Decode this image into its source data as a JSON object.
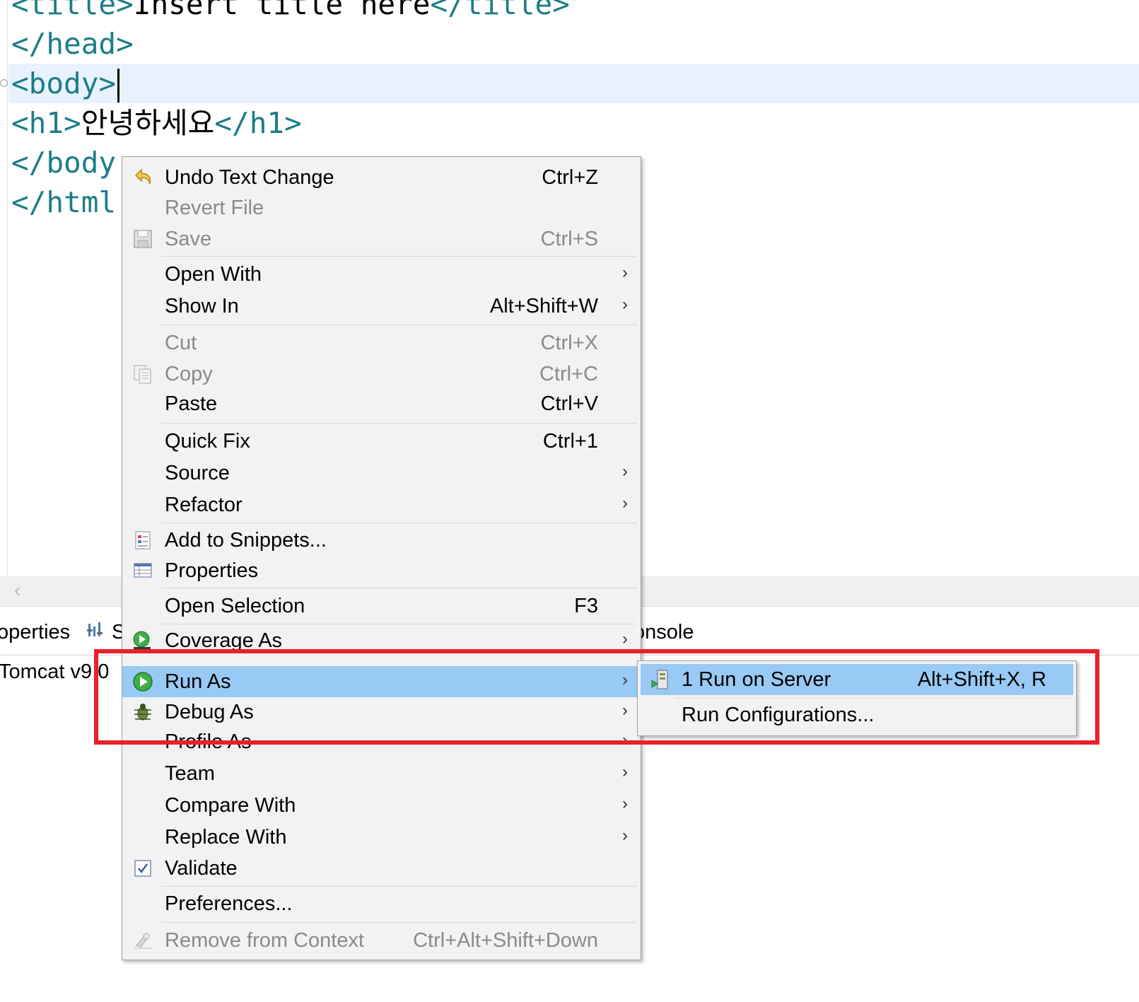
{
  "editor": {
    "lines": {
      "l1": {
        "open": "<title>",
        "text": "Insert title here",
        "close": "</title>"
      },
      "l2": {
        "tag": "</head>"
      },
      "l3": {
        "tag": "<body>"
      },
      "l4": {
        "open": "<h1>",
        "text": "안녕하세요",
        "close": "</h1>"
      },
      "l5": {
        "tag": "</body"
      },
      "l6": {
        "tag": "</html"
      }
    }
  },
  "bottom_panel": {
    "tab_properties": "operties",
    "tab_servers": "S",
    "tab_console": "onsole",
    "server_row": "Tomcat v9.0"
  },
  "context_menu": {
    "undo": {
      "label": "Undo Text Change",
      "shortcut": "Ctrl+Z"
    },
    "revert": {
      "label": "Revert File"
    },
    "save": {
      "label": "Save",
      "shortcut": "Ctrl+S"
    },
    "open_with": {
      "label": "Open With"
    },
    "show_in": {
      "label": "Show In",
      "shortcut": "Alt+Shift+W"
    },
    "cut": {
      "label": "Cut",
      "shortcut": "Ctrl+X"
    },
    "copy": {
      "label": "Copy",
      "shortcut": "Ctrl+C"
    },
    "paste": {
      "label": "Paste",
      "shortcut": "Ctrl+V"
    },
    "quick_fix": {
      "label": "Quick Fix",
      "shortcut": "Ctrl+1"
    },
    "source": {
      "label": "Source"
    },
    "refactor": {
      "label": "Refactor"
    },
    "add_snippets": {
      "label": "Add to Snippets..."
    },
    "properties": {
      "label": "Properties"
    },
    "open_selection": {
      "label": "Open Selection",
      "shortcut": "F3"
    },
    "coverage_as": {
      "label": "Coverage As"
    },
    "run_as": {
      "label": "Run As"
    },
    "debug_as": {
      "label": "Debug As"
    },
    "profile_as": {
      "label": "Profile As"
    },
    "team": {
      "label": "Team"
    },
    "compare_with": {
      "label": "Compare With"
    },
    "replace_with": {
      "label": "Replace With"
    },
    "validate": {
      "label": "Validate"
    },
    "preferences": {
      "label": "Preferences..."
    },
    "remove_context": {
      "label": "Remove from Context",
      "shortcut": "Ctrl+Alt+Shift+Down"
    },
    "submenu_arrow": "›"
  },
  "submenu": {
    "run_on_server": {
      "label": "1 Run on Server",
      "shortcut": "Alt+Shift+X, R"
    },
    "run_configurations": {
      "label": "Run Configurations..."
    }
  },
  "colors": {
    "highlight": "#99c9f5",
    "menu_bg": "#f2f2f2",
    "tag_color": "#1c7d86",
    "red_box": "#e8202a",
    "current_line": "#e8f2fe"
  },
  "icons": {
    "undo": "undo-arrow-icon",
    "save": "floppy-disk-icon",
    "copy": "copy-pages-icon",
    "snippets": "snippet-icon",
    "properties": "properties-table-icon",
    "coverage": "coverage-run-icon",
    "run": "run-green-play-icon",
    "debug": "debug-bug-icon",
    "validate": "checkbox-checked-icon",
    "remove_context": "remove-context-icon",
    "run_on_server": "server-run-icon"
  }
}
